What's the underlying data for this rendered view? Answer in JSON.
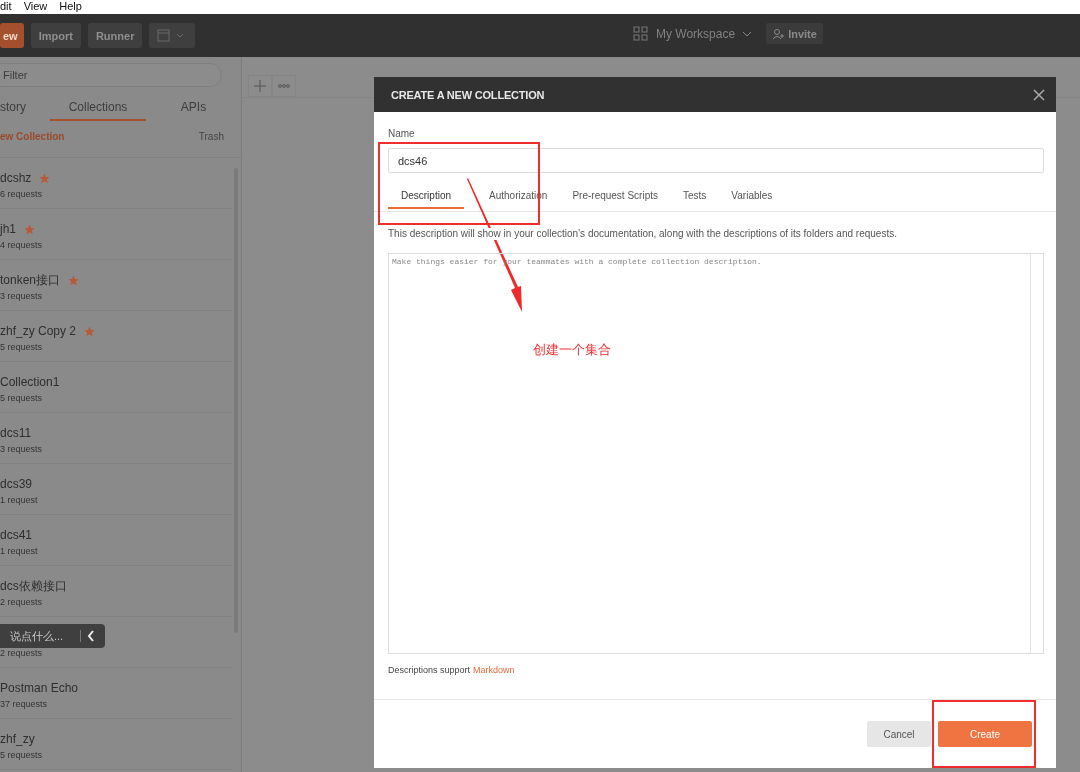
{
  "menu": [
    {
      "label": "dit"
    },
    {
      "label": "View"
    },
    {
      "label": "Help"
    }
  ],
  "toolbar": {
    "buttons": [
      {
        "label": "ew",
        "kind": "primary"
      },
      {
        "label": "Import",
        "kind": "plain"
      },
      {
        "label": "Runner",
        "kind": "plain"
      }
    ],
    "workspace": "My Workspace",
    "invite": "Invite"
  },
  "sidebar": {
    "filter_placeholder": "Filter",
    "tabs": [
      {
        "label": "story",
        "selected": false
      },
      {
        "label": "Collections",
        "selected": true
      },
      {
        "label": "APIs",
        "selected": false
      }
    ],
    "new_collection": "ew Collection",
    "trash": "Trash",
    "collections": [
      {
        "name": "dcshz",
        "requests": "6 requests",
        "starred": true
      },
      {
        "name": "jh1",
        "requests": "4 requests",
        "starred": true
      },
      {
        "name": "tonken接口",
        "requests": "3 requests",
        "starred": true
      },
      {
        "name": "zhf_zy Copy 2",
        "requests": "5 requests",
        "starred": true
      },
      {
        "name": "Collection1",
        "requests": "5 requests",
        "starred": false
      },
      {
        "name": "dcs11",
        "requests": "3 requests",
        "starred": false
      },
      {
        "name": "dcs39",
        "requests": "1 request",
        "starred": false
      },
      {
        "name": "dcs41",
        "requests": "1 request",
        "starred": false
      },
      {
        "name": "dcs依赖接口",
        "requests": "2 requests",
        "starred": false
      },
      {
        "requests": "2 requests",
        "starred": false
      },
      {
        "name": "Postman Echo",
        "requests": "37 requests",
        "starred": false
      },
      {
        "name": "zhf_zy",
        "requests": "5 requests",
        "starred": false
      }
    ]
  },
  "comment_widget": {
    "placeholder": "说点什么..."
  },
  "dialog": {
    "title": "CREATE A NEW COLLECTION",
    "name_label": "Name",
    "name_value": "dcs46",
    "tabs": [
      {
        "label": "Description",
        "selected": true
      },
      {
        "label": "Authorization",
        "selected": false
      },
      {
        "label": "Pre-request Scripts",
        "selected": false
      },
      {
        "label": "Tests",
        "selected": false
      },
      {
        "label": "Variables",
        "selected": false
      }
    ],
    "hint": "This description will show in your collection’s documentation, along with the descriptions of its folders and requests.",
    "description_placeholder": "Make things easier for your teammates with a complete collection description.",
    "support_text": "Descriptions support",
    "support_link": "Markdown",
    "buttons": [
      {
        "label": "Cancel",
        "kind": "secondary"
      },
      {
        "label": "Create",
        "kind": "primary"
      }
    ]
  },
  "annotation": {
    "label": "创建一个集合"
  }
}
